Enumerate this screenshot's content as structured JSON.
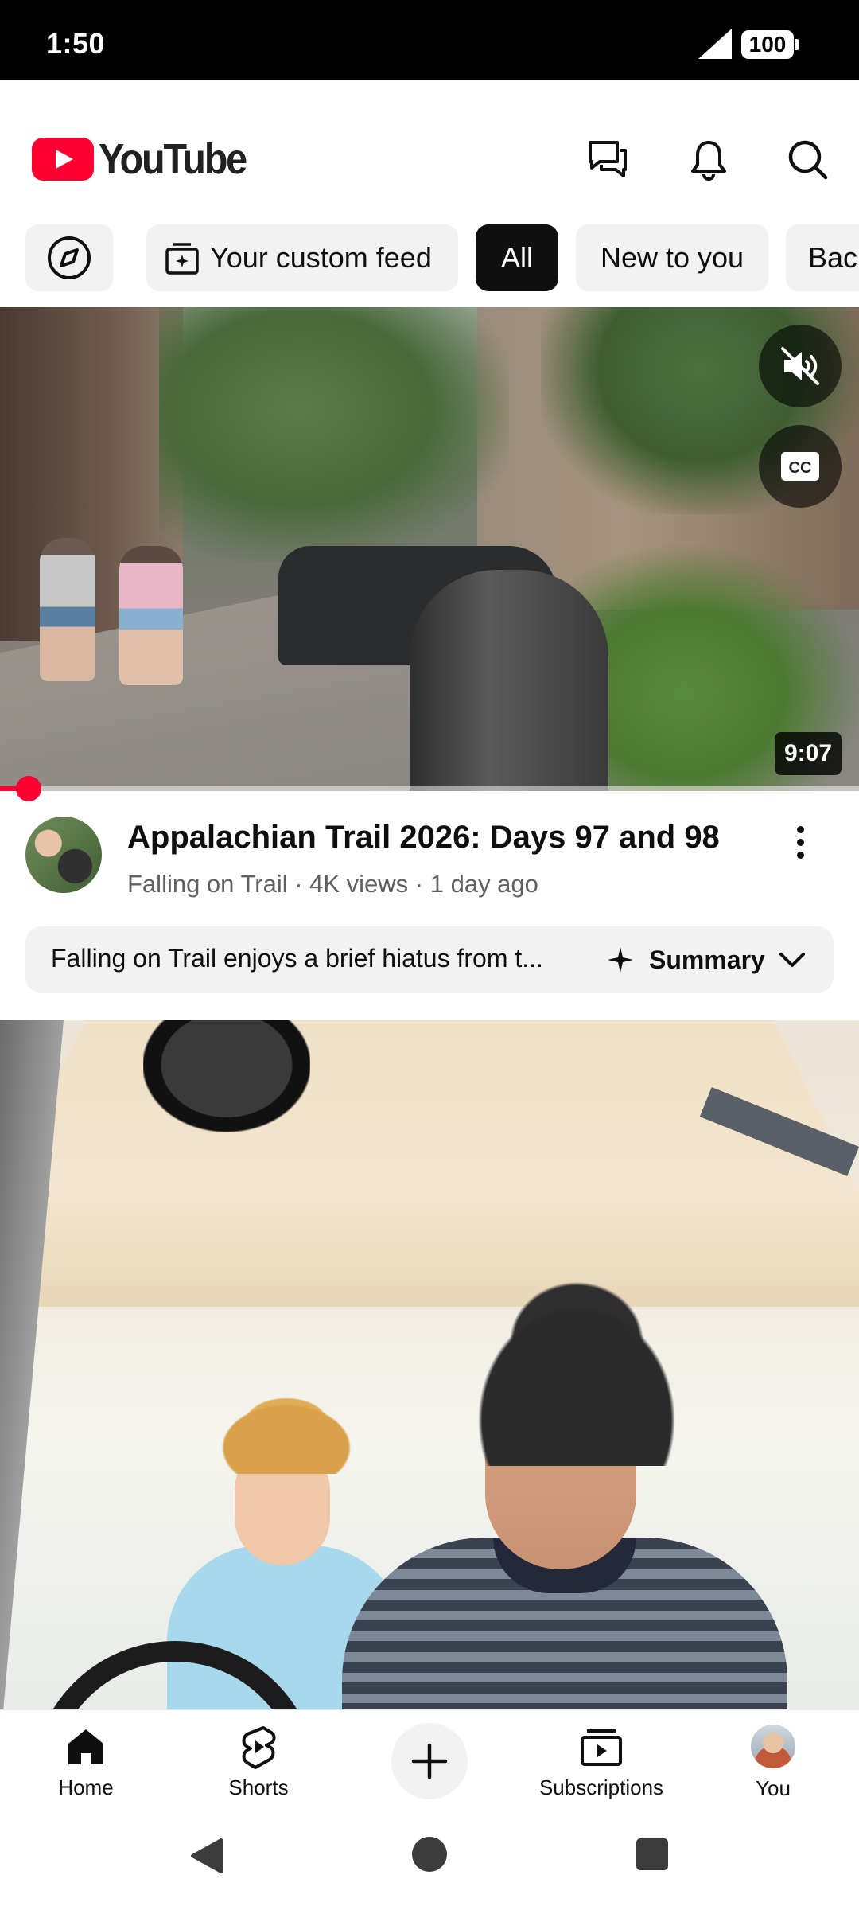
{
  "status_bar": {
    "time": "1:50",
    "battery": "100"
  },
  "header": {
    "logo_text": "YouTube"
  },
  "chips": {
    "custom_feed": "Your custom feed",
    "all": "All",
    "new_to_you": "New to you",
    "back": "Bac"
  },
  "video1": {
    "duration": "9:07",
    "progress": 0.02,
    "title": "Appalachian Trail 2026: Days 97 and 98",
    "meta": "Falling on Trail · 4K views · 1 day ago",
    "summary_text": "Falling on Trail enjoys a brief hiatus from t...",
    "summary_button": "Summary"
  },
  "bottom_nav": {
    "home": "Home",
    "shorts": "Shorts",
    "subscriptions": "Subscriptions",
    "you": "You"
  },
  "colors": {
    "accent": "#ff0033",
    "chip_active": "#0f0f0f",
    "chip_bg": "#f2f2f2",
    "meta_text": "#606060"
  },
  "icons": [
    "signal-icon",
    "battery-icon",
    "youtube-logo",
    "messages-icon",
    "bell-icon",
    "search-icon",
    "explore-compass-icon",
    "custom-feed-icon",
    "mute-icon",
    "captions-icon",
    "more-vert-icon",
    "sparkle-icon",
    "chevron-down-icon",
    "home-icon",
    "shorts-icon",
    "create-plus-icon",
    "subscriptions-icon"
  ]
}
